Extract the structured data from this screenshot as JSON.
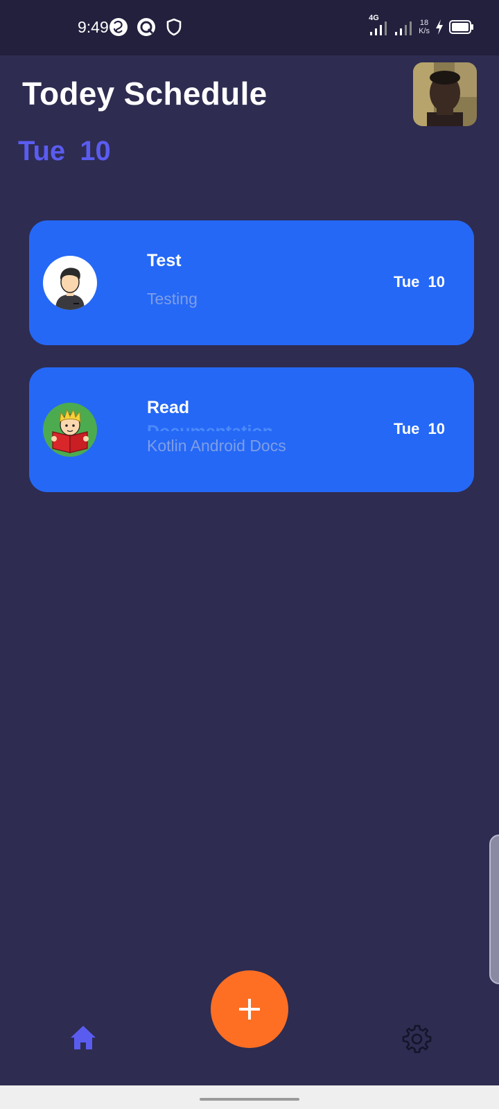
{
  "status_bar": {
    "time": "9:49",
    "network": "4G",
    "speed_value": "18",
    "speed_unit": "K/s",
    "icons": [
      "app-swirl-icon",
      "app-q-icon",
      "shield-icon",
      "signal-icon",
      "signal-icon",
      "charging-bolt-icon",
      "battery-icon"
    ]
  },
  "header": {
    "title": "Todey Schedule",
    "date": "Tue  10",
    "avatar_icon": "profile-photo"
  },
  "tasks": [
    {
      "title": "Test",
      "subtitle": "Testing",
      "date": "Tue 10",
      "icon": "male-avatar-icon"
    },
    {
      "title": "Read",
      "hidden_text": "Documentation",
      "subtitle": "Kotlin Android Docs",
      "date": "Tue 10",
      "icon": "reading-boy-icon"
    }
  ],
  "bottom_nav": {
    "home_icon": "home-icon",
    "add_icon": "plus-icon",
    "settings_icon": "gear-icon"
  },
  "colors": {
    "background": "#2e2c51",
    "status_bar": "#22203d",
    "card": "#2568f6",
    "accent_date": "#5a5cf0",
    "fab": "#ff6f23",
    "home_icon": "#5a5cf0"
  }
}
